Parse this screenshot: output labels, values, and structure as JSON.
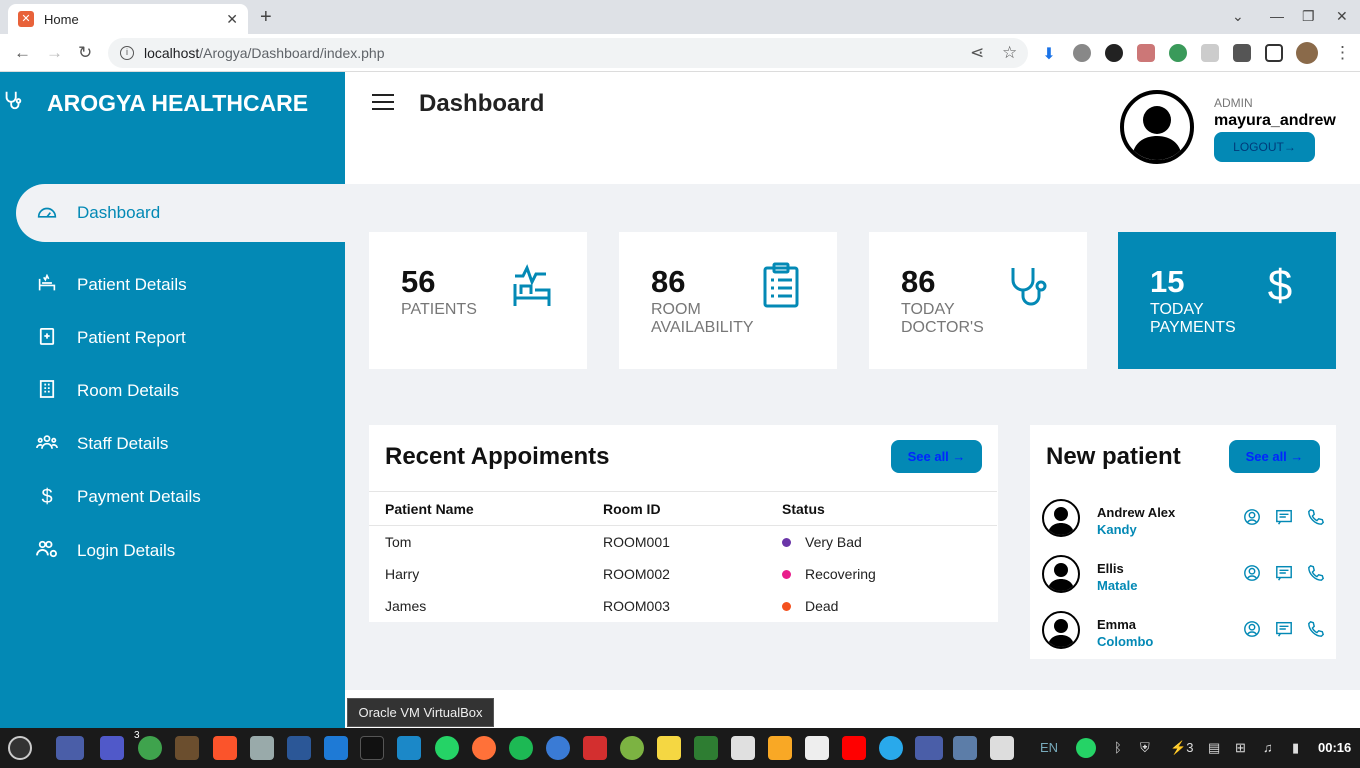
{
  "browser": {
    "tab_title": "Home",
    "url_host": "localhost",
    "url_path": "/Arogya/Dashboard/index.php"
  },
  "sidebar": {
    "brand": "AROGYA HEALTHCARE",
    "items": [
      {
        "label": "Dashboard",
        "icon": "dashboard-icon"
      },
      {
        "label": "Patient Details",
        "icon": "patient-bed-icon"
      },
      {
        "label": "Patient Report",
        "icon": "report-icon"
      },
      {
        "label": "Room Details",
        "icon": "building-icon"
      },
      {
        "label": "Staff Details",
        "icon": "staff-group-icon"
      },
      {
        "label": "Payment Details",
        "icon": "dollar-icon"
      },
      {
        "label": "Login Details",
        "icon": "users-gear-icon"
      }
    ]
  },
  "header": {
    "title": "Dashboard",
    "role": "ADMIN",
    "username": "mayura_andrew",
    "logout": "LOGOUT→"
  },
  "cards": [
    {
      "value": "56",
      "label": "PATIENTS",
      "icon": "bed-pulse-icon"
    },
    {
      "value": "86",
      "label": "ROOM AVAILABILITY",
      "icon": "clipboard-icon"
    },
    {
      "value": "86",
      "label": "TODAY DOCTOR'S",
      "icon": "stethoscope-icon"
    },
    {
      "value": "15",
      "label": "TODAY PAYMENTS",
      "icon": "dollar-icon"
    }
  ],
  "appointments": {
    "title": "Recent Appoiments",
    "see_all": "See all →",
    "columns": [
      "Patient Name",
      "Room ID",
      "Status"
    ],
    "rows": [
      {
        "name": "Tom",
        "room": "ROOM001",
        "status": "Very Bad",
        "color": "#6a35a8"
      },
      {
        "name": "Harry",
        "room": "ROOM002",
        "status": "Recovering",
        "color": "#e91e8c"
      },
      {
        "name": "James",
        "room": "ROOM003",
        "status": "Dead",
        "color": "#f4511e"
      }
    ]
  },
  "new_patients": {
    "title": "New patient",
    "see_all": "See all →",
    "items": [
      {
        "name": "Andrew Alex",
        "city": "Kandy"
      },
      {
        "name": "Ellis",
        "city": "Matale"
      },
      {
        "name": "Emma",
        "city": "Colombo"
      }
    ]
  },
  "tooltip": "Oracle VM VirtualBox",
  "taskbar": {
    "lang": "EN",
    "badge": "3",
    "tray_count": "3",
    "clock": "00:16"
  },
  "colors": {
    "accent": "#0389b5",
    "background": "#f0f2f5"
  }
}
